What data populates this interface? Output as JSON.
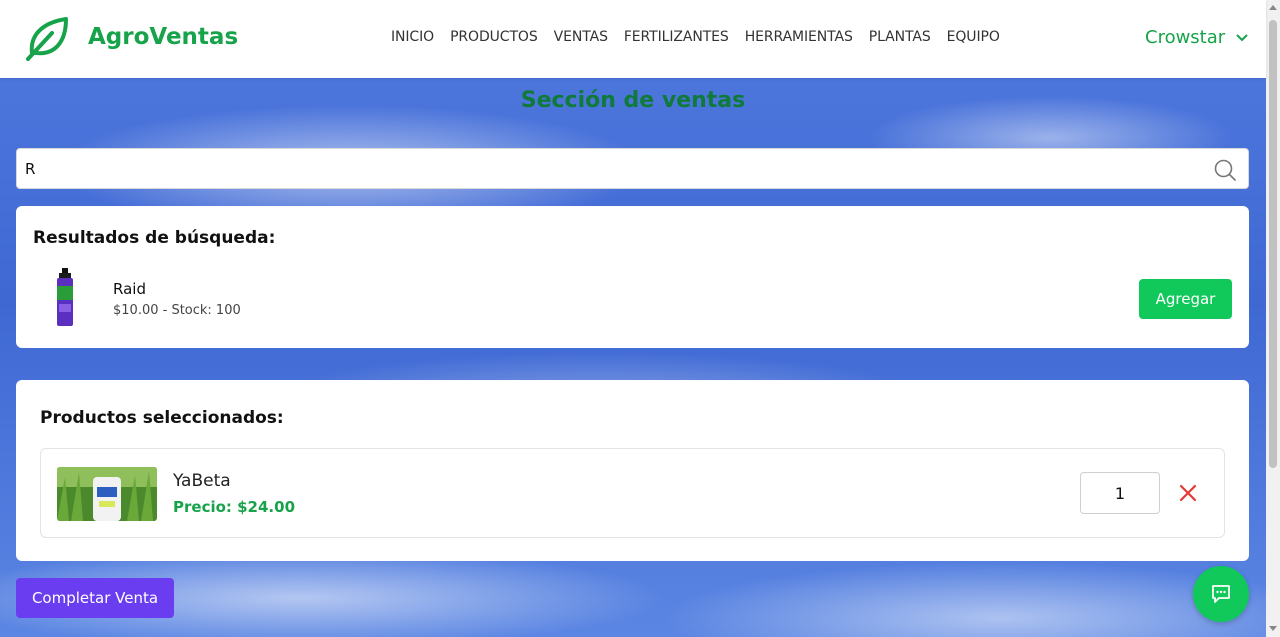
{
  "header": {
    "brand": "AgroVentas",
    "nav": [
      "INICIO",
      "PRODUCTOS",
      "VENTAS",
      "FERTILIZANTES",
      "HERRAMIENTAS",
      "PLANTAS",
      "EQUIPO"
    ],
    "user": "Crowstar"
  },
  "page": {
    "title": "Sección de ventas"
  },
  "search": {
    "value": "R"
  },
  "results": {
    "title": "Resultados de búsqueda:",
    "items": [
      {
        "name": "Raid",
        "details": "$10.00 - Stock: 100",
        "button": "Agregar"
      }
    ]
  },
  "selected": {
    "title": "Productos seleccionados:",
    "items": [
      {
        "name": "YaBeta",
        "price": "Precio: $24.00",
        "quantity": "1"
      }
    ]
  },
  "actions": {
    "complete": "Completar Venta"
  },
  "colors": {
    "brand": "#17a34a",
    "add_button": "#10c95a",
    "complete_button": "#6a3df0",
    "remove": "#e53935"
  }
}
